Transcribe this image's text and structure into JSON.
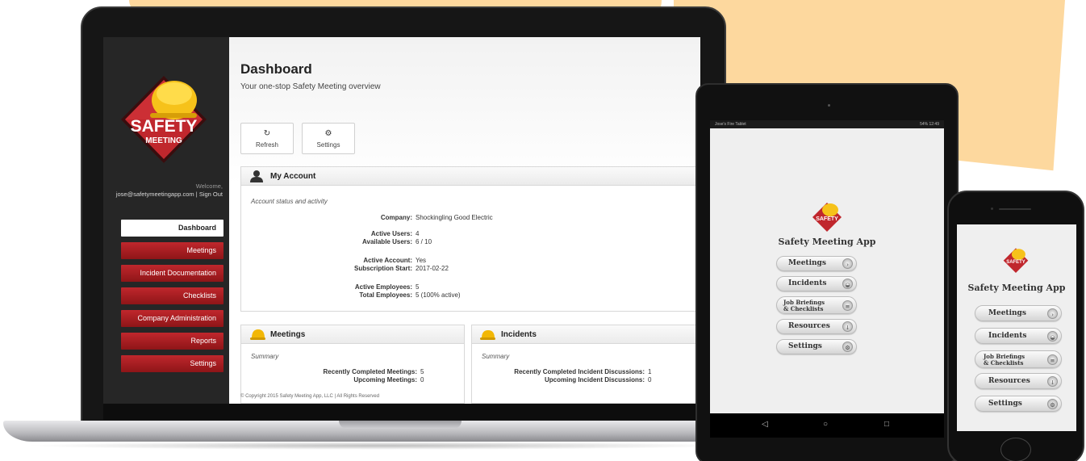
{
  "colors": {
    "accent_red": "#c0272d",
    "sidebar_bg": "#262626",
    "backdrop": "#fdd89e"
  },
  "logo": {
    "line1": "SAFETY",
    "line2": "MEETING"
  },
  "sidebar": {
    "welcome_label": "Welcome,",
    "email": "jose@safetymeetingapp.com",
    "sign_out": "| Sign Out",
    "items": [
      {
        "label": "Dashboard",
        "active": true
      },
      {
        "label": "Meetings"
      },
      {
        "label": "Incident Documentation"
      },
      {
        "label": "Checklists"
      },
      {
        "label": "Company Administration"
      },
      {
        "label": "Reports"
      },
      {
        "label": "Settings"
      }
    ]
  },
  "main": {
    "title": "Dashboard",
    "subtitle": "Your one-stop Safety Meeting overview",
    "toolbar": {
      "refresh": "Refresh",
      "settings": "Settings",
      "refresh_icon": "refresh-icon",
      "settings_icon": "gear-icon"
    },
    "account": {
      "title": "My Account",
      "subtitle": "Account status and activity",
      "rows": [
        {
          "k": "Company:",
          "v": "Shockingling Good Electric"
        },
        {
          "k": "Active Users:",
          "v": "4"
        },
        {
          "k": "Available Users:",
          "v": "6 / 10"
        },
        {
          "k": "Active Account:",
          "v": "Yes"
        },
        {
          "k": "Subscription Start:",
          "v": "2017-02-22"
        },
        {
          "k": "Active Employees:",
          "v": "5"
        },
        {
          "k": "Total Employees:",
          "v": "5 (100% active)"
        }
      ]
    },
    "meetings": {
      "title": "Meetings",
      "subtitle": "Summary",
      "rows": [
        {
          "k": "Recently Completed Meetings:",
          "v": "5"
        },
        {
          "k": "Upcoming Meetings:",
          "v": "0"
        }
      ]
    },
    "incidents": {
      "title": "Incidents",
      "subtitle": "Summary",
      "rows": [
        {
          "k": "Recently Completed Incident Discussions:",
          "v": "1"
        },
        {
          "k": "Upcoming Incident Discussions:",
          "v": "0"
        }
      ]
    },
    "copyright": "© Copyright 2015 Safety Meeting App, LLC | All Rights Reserved"
  },
  "tablet": {
    "status_left": "Jose's Fire Tablet",
    "status_right": "54% 12:49",
    "app_title": "Safety Meeting App",
    "logo": "SAFETY",
    "buttons": [
      "Meetings",
      "Incidents",
      "Job Briefings",
      "& Checklists",
      "Resources",
      "Settings"
    ],
    "nav": {
      "back": "◁",
      "home": "○",
      "recent": "□"
    }
  },
  "phone": {
    "app_title": "Safety Meeting App",
    "logo": "SAFETY",
    "buttons": [
      "Meetings",
      "Incidents",
      "Job Briefings",
      "& Checklists",
      "Resources",
      "Settings"
    ]
  }
}
